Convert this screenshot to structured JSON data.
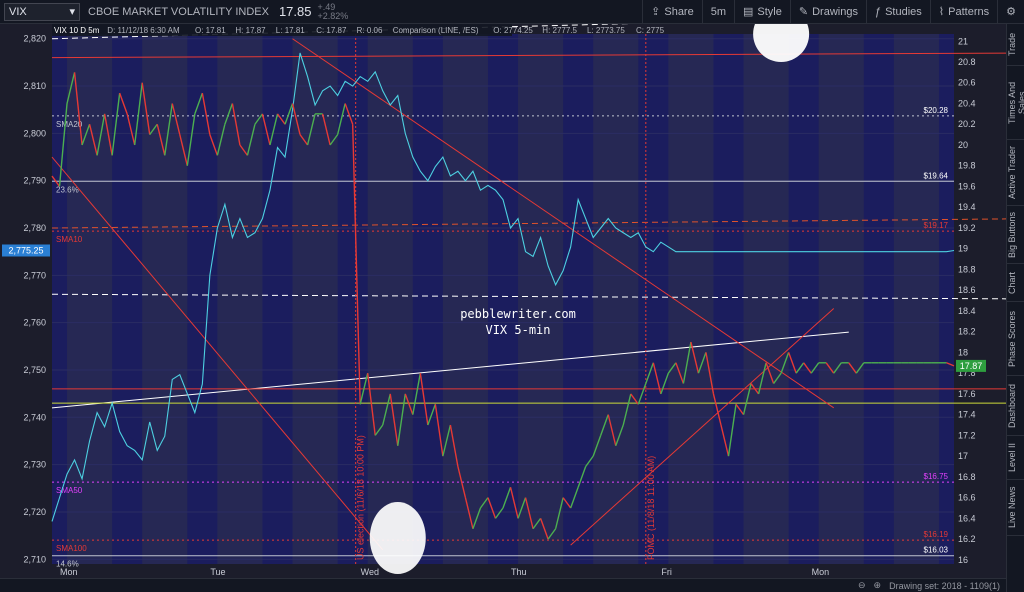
{
  "toolbar": {
    "symbol": "VIX",
    "description": "CBOE MARKET VOLATILITY INDEX",
    "last": "17.85",
    "change": "+.49",
    "change_pct": "+2.82%",
    "share": "Share",
    "interval": "5m",
    "style": "Style",
    "drawings": "Drawings",
    "studies": "Studies",
    "patterns": "Patterns"
  },
  "legend": {
    "title": "VIX 10 D 5m",
    "date": "D: 11/12/18 6:30 AM",
    "ohlc": [
      "O: 17.81",
      "H: 17.87",
      "L: 17.81",
      "C: 17.87",
      "R: 0.06"
    ],
    "comparison": "Comparison (LINE, /ES)",
    "comparison_values": [
      "O: 2774.25",
      "H: 2777.5",
      "L: 2773.75",
      "C: 2775"
    ]
  },
  "side_tabs": [
    "Trade",
    "Times And Sales",
    "Active Trader",
    "Big Buttons",
    "Chart",
    "Phase Scores",
    "Dashboard",
    "Level II",
    "Live News"
  ],
  "status": {
    "drawing_set": "Drawing set: 2018 - 1109(1)"
  },
  "colors": {
    "background": "#1b1d5e",
    "band_light": "#2b2c52",
    "vix_up": "#4caf50",
    "vix_down": "#e53935",
    "es_line": "#4dd0e1",
    "accent_last": "#2e9e3f"
  },
  "chart_data": {
    "type": "line",
    "left_axis": {
      "label": "/ES",
      "ticks": [
        2820,
        2810,
        2800,
        2790,
        2780,
        2770,
        2760,
        2750,
        2740,
        2730,
        2720,
        2710
      ],
      "tick_labels": [
        "2,820",
        "2,810",
        "2,800",
        "2,790",
        "2,780",
        "2,770",
        "2,760",
        "2,750",
        "2,740",
        "2,730",
        "2,720",
        "2,710"
      ],
      "ylim": [
        2709,
        2821
      ]
    },
    "right_axis": {
      "label": "VIX",
      "ticks": [
        21,
        20.8,
        20.6,
        20.4,
        20.2,
        20,
        19.8,
        19.6,
        19.4,
        19.2,
        19,
        18.8,
        18.6,
        18.4,
        18.2,
        18,
        17.8,
        17.6,
        17.4,
        17.2,
        17,
        16.8,
        16.6,
        16.4,
        16.2,
        16
      ],
      "tick_labels": [
        "21",
        "20.8",
        "20.6",
        "20.4",
        "20.2",
        "20",
        "19.8",
        "19.6",
        "19.4",
        "19.2",
        "19",
        "18.8",
        "18.6",
        "18.4",
        "18.2",
        "18",
        "17.8",
        "17.6",
        "17.4",
        "17.2",
        "17",
        "16.8",
        "16.6",
        "16.4",
        "16.2",
        "16"
      ],
      "ylim": [
        15.96,
        21.07
      ]
    },
    "x_labels": [
      "Mon",
      "Tue",
      "Wed",
      "Thu",
      "Fri",
      "Mon"
    ],
    "last_es_label": "2,775.25",
    "last_vix_label": "17.87",
    "watermark": [
      "pebblewriter.com",
      "VIX 5-min"
    ],
    "levels": [
      {
        "name": "SMA20",
        "value_label": "$20.28",
        "vix": 20.28,
        "color": "#c0c4d0",
        "dash": "2,3"
      },
      {
        "name": "23.6%",
        "value_label": "$19.64",
        "vix": 19.65,
        "color": "#c0c4d0",
        "dash": ""
      },
      {
        "name": "SMA10",
        "value_label": "$19.17",
        "vix": 19.17,
        "color": "#e53935",
        "dash": "2,3"
      },
      {
        "name": "SMA50",
        "value_label": "$16.75",
        "vix": 16.75,
        "color": "#e040fb",
        "dash": "2,3"
      },
      {
        "name": "SMA100",
        "value_label": "$16.19",
        "vix": 16.19,
        "color": "#e53935",
        "dash": "2,3"
      },
      {
        "name": "14.6%",
        "value_label": "$16.03",
        "vix": 16.04,
        "color": "#c0c4d0",
        "dash": ""
      }
    ],
    "event_labels": [
      "US election (11/6/18 10:00 PM)",
      "FOMC (11/8/18 11:00 AM)"
    ],
    "series": [
      {
        "name": "VIX",
        "x": [
          0,
          0.05,
          0.1,
          0.15,
          0.2,
          0.25,
          0.3,
          0.35,
          0.4,
          0.45,
          0.5,
          0.55,
          0.6,
          0.65,
          0.7,
          0.75,
          0.8,
          0.85,
          0.9,
          0.95,
          1.0,
          1.05,
          1.1,
          1.15,
          1.2,
          1.25,
          1.3,
          1.35,
          1.4,
          1.45,
          1.5,
          1.55,
          1.6,
          1.65,
          1.7,
          1.75,
          1.8,
          1.85,
          1.9,
          1.95,
          2.0,
          2.05,
          2.1,
          2.15,
          2.2,
          2.25,
          2.3,
          2.35,
          2.4,
          2.45,
          2.5,
          2.55,
          2.6,
          2.65,
          2.7,
          2.75,
          2.8,
          2.85,
          2.9,
          2.95,
          3.0,
          3.05,
          3.1,
          3.15,
          3.2,
          3.25,
          3.3,
          3.35,
          3.4,
          3.45,
          3.5,
          3.55,
          3.6,
          3.65,
          3.7,
          3.75,
          3.8,
          3.85,
          3.9,
          3.95,
          4.0,
          4.05,
          4.1,
          4.15,
          4.2,
          4.25,
          4.3,
          4.35,
          4.4,
          4.45,
          4.5,
          4.55,
          4.6,
          4.65,
          4.7,
          4.75,
          4.8,
          4.85,
          4.9,
          4.95,
          5.0,
          5.05,
          5.1,
          5.15,
          5.2,
          5.25,
          5.3,
          5.35,
          5.4,
          5.45,
          5.5,
          5.55,
          5.6,
          5.65,
          5.7,
          5.75,
          5.8,
          5.85,
          5.9,
          5.95,
          6.0
        ],
        "values": [
          19.7,
          19.6,
          20.4,
          20.7,
          20.0,
          20.2,
          19.9,
          20.3,
          19.9,
          20.5,
          20.3,
          20.0,
          20.6,
          20.1,
          20.2,
          19.9,
          20.4,
          20.1,
          19.8,
          20.3,
          20.5,
          20.1,
          19.9,
          20.2,
          20.4,
          20.0,
          19.9,
          20.2,
          20.3,
          20.0,
          20.3,
          20.2,
          20.4,
          20.1,
          20.0,
          20.3,
          20.3,
          20.0,
          20.1,
          20.4,
          20.2,
          17.5,
          17.8,
          17.2,
          17.3,
          17.6,
          17.1,
          17.6,
          17.4,
          17.8,
          17.3,
          17.5,
          17.0,
          17.3,
          16.9,
          16.6,
          16.3,
          16.5,
          16.6,
          16.4,
          16.5,
          16.7,
          16.4,
          16.6,
          16.3,
          16.4,
          16.2,
          16.3,
          16.6,
          16.5,
          16.7,
          16.9,
          17.0,
          17.2,
          17.4,
          17.1,
          17.3,
          17.6,
          17.5,
          17.7,
          17.9,
          17.6,
          17.8,
          17.9,
          17.7,
          18.1,
          17.8,
          18.0,
          17.6,
          17.3,
          17.0,
          17.5,
          17.4,
          17.7,
          17.6,
          17.9,
          17.7,
          17.8,
          18.0,
          17.8,
          17.9,
          17.8,
          17.9,
          17.9,
          17.8,
          17.9,
          17.9,
          17.8,
          17.9,
          17.9,
          17.9,
          17.9,
          17.9,
          17.9,
          17.9,
          17.9,
          17.9,
          17.9,
          17.9,
          17.9,
          17.87
        ]
      },
      {
        "name": "/ES",
        "x": [
          0,
          0.05,
          0.1,
          0.15,
          0.2,
          0.25,
          0.3,
          0.35,
          0.4,
          0.45,
          0.5,
          0.55,
          0.6,
          0.65,
          0.7,
          0.75,
          0.8,
          0.85,
          0.9,
          0.95,
          1.0,
          1.05,
          1.1,
          1.15,
          1.2,
          1.25,
          1.3,
          1.35,
          1.4,
          1.45,
          1.5,
          1.55,
          1.6,
          1.65,
          1.7,
          1.75,
          1.8,
          1.85,
          1.9,
          1.95,
          2.0,
          2.05,
          2.1,
          2.15,
          2.2,
          2.25,
          2.3,
          2.35,
          2.4,
          2.45,
          2.5,
          2.55,
          2.6,
          2.65,
          2.7,
          2.75,
          2.8,
          2.85,
          2.9,
          2.95,
          3.0,
          3.05,
          3.1,
          3.15,
          3.2,
          3.25,
          3.3,
          3.35,
          3.4,
          3.45,
          3.5,
          3.55,
          3.6,
          3.65,
          3.7,
          3.75,
          3.8,
          3.85,
          3.9,
          3.95,
          4.0,
          4.05,
          4.1,
          4.15,
          4.2,
          4.25,
          4.3,
          4.35,
          4.4,
          4.45,
          4.5,
          4.55,
          4.6,
          4.65,
          4.7,
          4.75,
          4.8,
          4.85,
          4.9,
          4.95,
          5.0,
          5.05,
          5.1,
          5.15,
          5.2,
          5.25,
          5.3,
          5.35,
          5.4,
          5.45,
          5.5,
          5.55,
          5.6,
          5.65,
          5.7,
          5.75,
          5.8,
          5.85,
          5.9,
          5.95,
          6.0
        ],
        "values": [
          2718,
          2723,
          2728,
          2731,
          2727,
          2735,
          2741,
          2738,
          2743,
          2737,
          2734,
          2733,
          2731,
          2739,
          2733,
          2736,
          2748,
          2749,
          2745,
          2741,
          2747,
          2770,
          2780,
          2785,
          2778,
          2782,
          2778,
          2779,
          2782,
          2788,
          2797,
          2795,
          2805,
          2817,
          2812,
          2806,
          2809,
          2810,
          2808,
          2811,
          2810,
          2812,
          2811,
          2813,
          2809,
          2806,
          2808,
          2800,
          2795,
          2792,
          2790,
          2793,
          2795,
          2791,
          2792,
          2790,
          2792,
          2788,
          2789,
          2788,
          2786,
          2780,
          2782,
          2775,
          2774,
          2778,
          2772,
          2768,
          2771,
          2776,
          2786,
          2782,
          2778,
          2780,
          2782,
          2780,
          2779,
          2778,
          2779,
          2776,
          2775,
          2777,
          2776,
          2775,
          2775,
          2775,
          2775,
          2775,
          2775,
          2775,
          2775,
          2775,
          2775,
          2775,
          2775,
          2775,
          2775,
          2775,
          2775,
          2775,
          2775,
          2775,
          2775,
          2775,
          2775,
          2775,
          2775,
          2775,
          2775,
          2775,
          2775,
          2775,
          2775,
          2775,
          2775,
          2775,
          2775,
          2775,
          2775,
          2775,
          2775.25
        ]
      }
    ]
  }
}
